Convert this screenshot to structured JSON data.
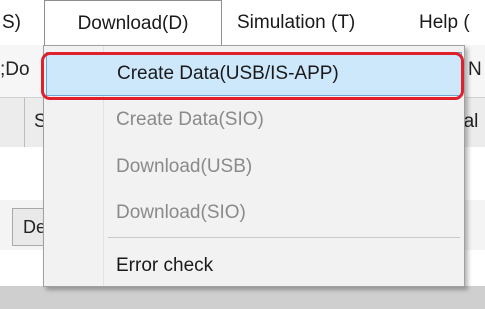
{
  "menubar": {
    "tools_fragment": "S)",
    "download_label": "Download(D)",
    "simulation_label": "Simulation (T)",
    "help_fragment": "Help ("
  },
  "background": {
    "row1_left": ";Do",
    "row1_right": "N",
    "row2_left": "S",
    "row2_right": "bal",
    "button_fragment": "De"
  },
  "dropdown": {
    "items": [
      {
        "label": "Create Data(USB/IS-APP)",
        "enabled": true,
        "selected": true
      },
      {
        "label": "Create Data(SIO)",
        "enabled": false
      },
      {
        "label": "Download(USB)",
        "enabled": false
      },
      {
        "label": "Download(SIO)",
        "enabled": false
      },
      {
        "label": "Error check",
        "enabled": true
      }
    ]
  },
  "colors": {
    "selection_bg": "#cde7fb",
    "selection_border": "#6aa8dc",
    "highlight_red": "#e0202a",
    "disabled_text": "#8a8a8a"
  }
}
